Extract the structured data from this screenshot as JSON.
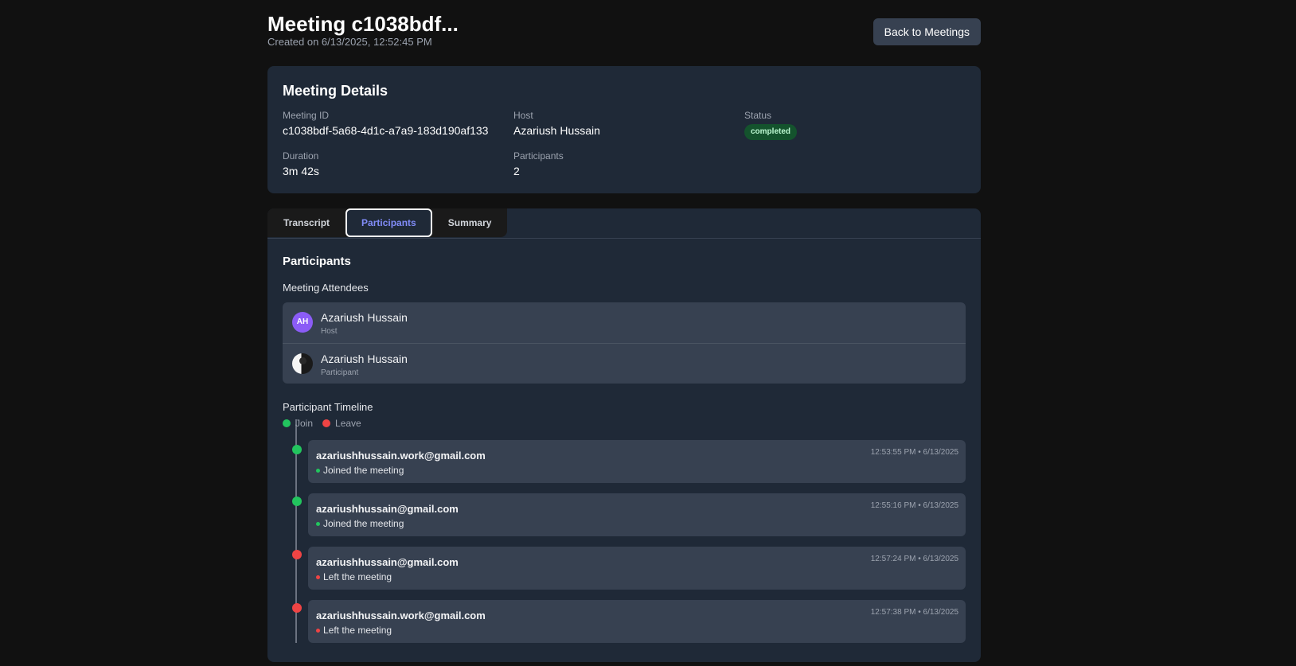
{
  "header": {
    "title": "Meeting c1038bdf...",
    "created": "Created on 6/13/2025, 12:52:45 PM",
    "back_label": "Back to Meetings"
  },
  "details": {
    "heading": "Meeting Details",
    "meeting_id_label": "Meeting ID",
    "meeting_id": "c1038bdf-5a68-4d1c-a7a9-183d190af133",
    "host_label": "Host",
    "host": "Azariush Hussain",
    "status_label": "Status",
    "status": "completed",
    "duration_label": "Duration",
    "duration": "3m 42s",
    "participants_label": "Participants",
    "participants": "2"
  },
  "tabs": [
    {
      "label": "Transcript"
    },
    {
      "label": "Participants"
    },
    {
      "label": "Summary"
    }
  ],
  "participants": {
    "title": "Participants",
    "attendees_heading": "Meeting Attendees",
    "attendees": [
      {
        "initials": "AH",
        "name": "Azariush Hussain",
        "role": "Host"
      },
      {
        "name": "Azariush Hussain",
        "role": "Participant"
      }
    ],
    "timeline_heading": "Participant Timeline",
    "legend": {
      "join": "Join",
      "leave": "Leave"
    },
    "events": [
      {
        "email": "azariushhussain.work@gmail.com",
        "action": "Joined the meeting",
        "time": "12:53:55 PM • 6/13/2025",
        "type": "join"
      },
      {
        "email": "azariushhussain@gmail.com",
        "action": "Joined the meeting",
        "time": "12:55:16 PM • 6/13/2025",
        "type": "join"
      },
      {
        "email": "azariushhussain@gmail.com",
        "action": "Left the meeting",
        "time": "12:57:24 PM • 6/13/2025",
        "type": "leave"
      },
      {
        "email": "azariushhussain.work@gmail.com",
        "action": "Left the meeting",
        "time": "12:57:38 PM • 6/13/2025",
        "type": "leave"
      }
    ]
  },
  "colors": {
    "join": "#22c55e",
    "leave": "#ef4444",
    "accent": "#818cf8",
    "card": "#1f2937",
    "background": "#111111"
  }
}
